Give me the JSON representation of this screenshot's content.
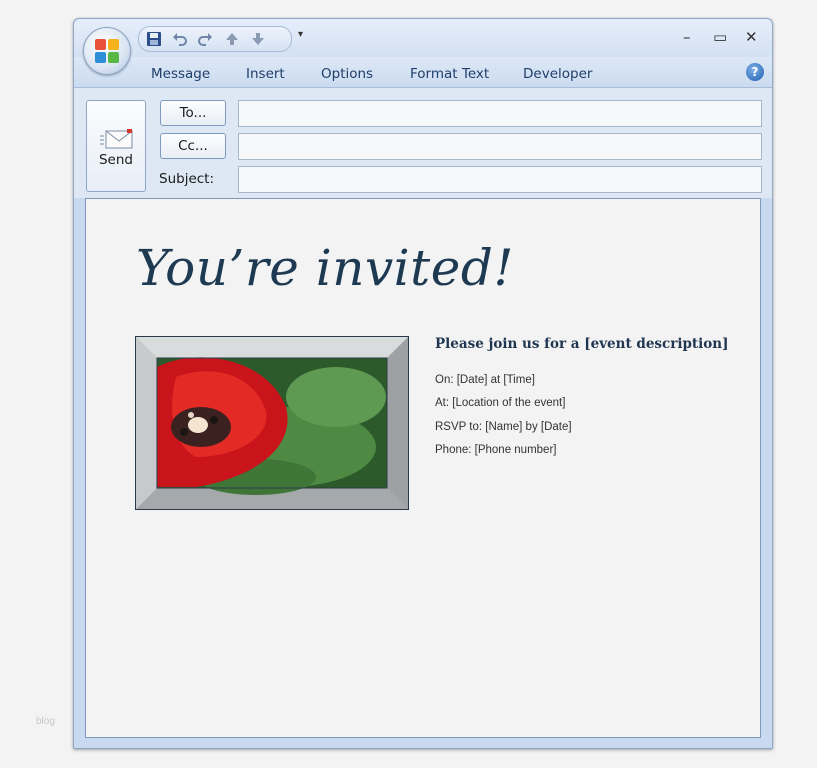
{
  "window": {
    "controls": {
      "minimize": "–",
      "maximize": "▭",
      "close": "✕"
    }
  },
  "quick_access": {
    "icons": [
      "save-icon",
      "undo-icon",
      "redo-icon",
      "up-arrow-icon",
      "down-arrow-icon"
    ],
    "dropdown": "▾"
  },
  "ribbon": {
    "tabs": [
      "Message",
      "Insert",
      "Options",
      "Format Text",
      "Developer"
    ],
    "help": "?"
  },
  "compose": {
    "send_label": "Send",
    "to_label": "To...",
    "cc_label": "Cc...",
    "subject_label": "Subject:",
    "to_value": "",
    "cc_value": "",
    "subject_value": ""
  },
  "invitation": {
    "title": "You’re invited!",
    "heading": "Please join us for a [event description]",
    "lines": [
      "On:   [Date] at [Time]",
      "At:  [Location of the event]",
      "RSVP to:  [Name] by [Date]",
      "Phone:  [Phone number]"
    ]
  },
  "watermark": "blog",
  "colors": {
    "window_bg": "#c9daf0",
    "title_text": "#1d3a52",
    "ribbon_text": "#1e3f6a"
  }
}
